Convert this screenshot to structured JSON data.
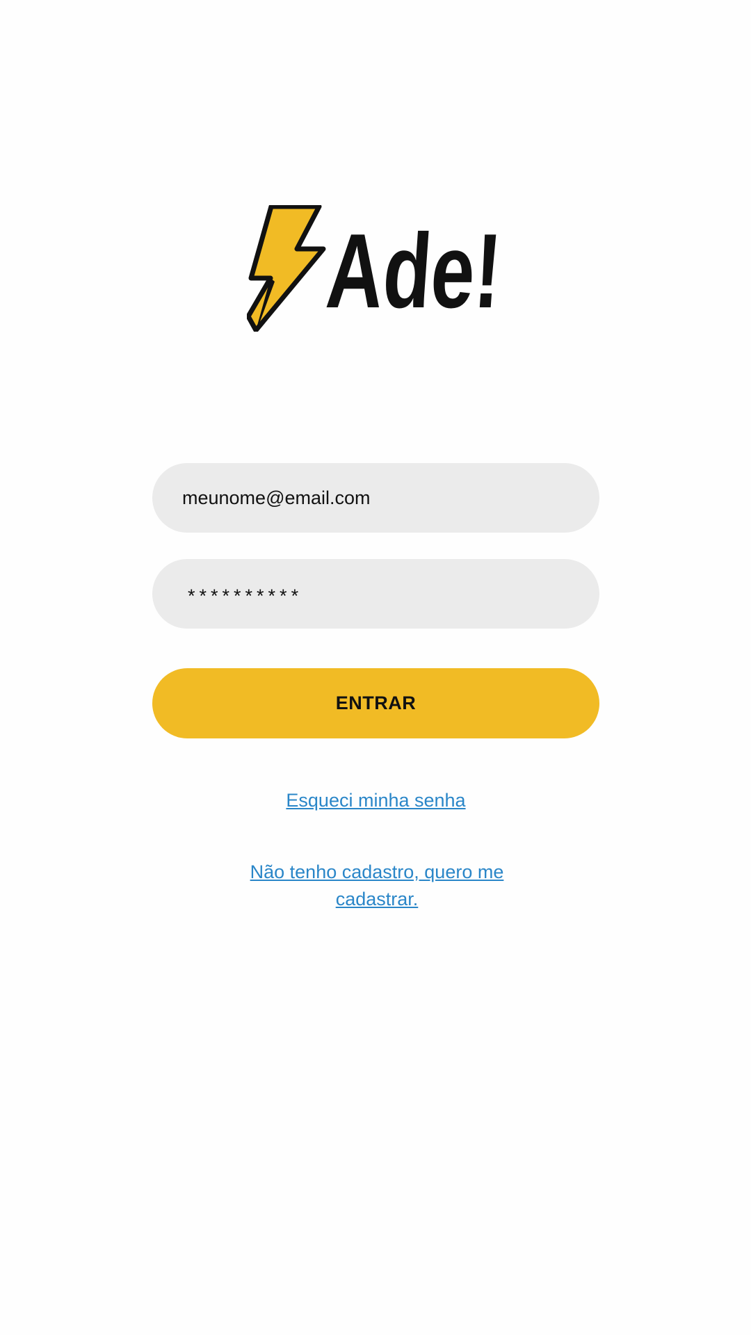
{
  "logo": {
    "text": "Ade!",
    "icon": "lightning-bolt-icon",
    "bolt_color": "#f1bb25",
    "text_color": "#111111"
  },
  "login": {
    "email_value": "meunome@email.com",
    "password_value": "**********",
    "submit_label": "ENTRAR",
    "forgot_password_link": "Esqueci minha senha",
    "register_link": "Não tenho cadastro, quero me cadastrar."
  },
  "colors": {
    "accent": "#f1bb25",
    "link": "#2a86c8",
    "field_background": "#ebebeb"
  }
}
